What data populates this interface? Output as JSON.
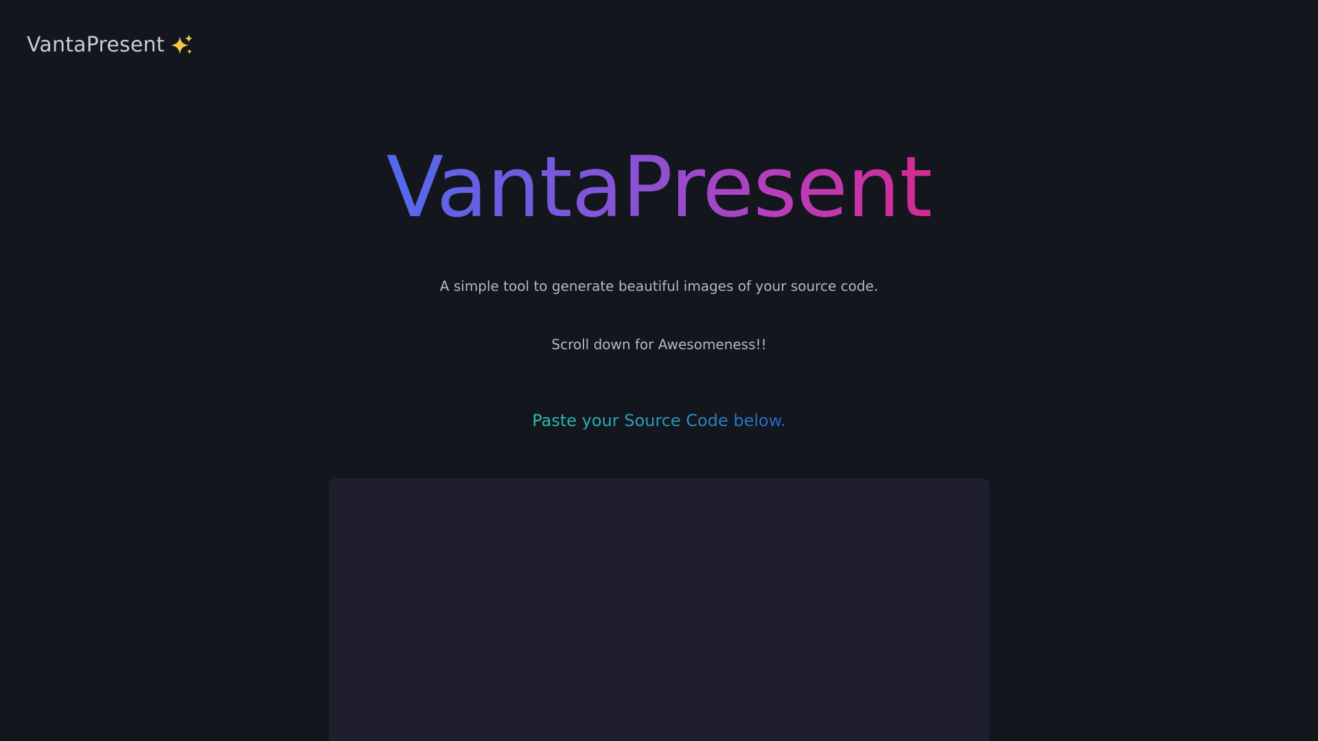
{
  "header": {
    "brand_label": "VantaPresent",
    "brand_icon": "sparkles-icon"
  },
  "hero": {
    "title": "VantaPresent",
    "subtitle": "A simple tool to generate beautiful images of your source code.",
    "scroll_hint": "Scroll down for Awesomeness!!"
  },
  "editor": {
    "prompt": "Paste your Source Code below.",
    "value": ""
  },
  "colors": {
    "background": "#13161d",
    "editor_background": "#1f1e2c",
    "title_gradient": [
      "#5269ec",
      "#8a52d6",
      "#bb3cb8",
      "#d32b91"
    ],
    "prompt_gradient": [
      "#2ebfae",
      "#2f9fbe",
      "#2c63c9"
    ],
    "muted_text": "#b5b8c1"
  }
}
